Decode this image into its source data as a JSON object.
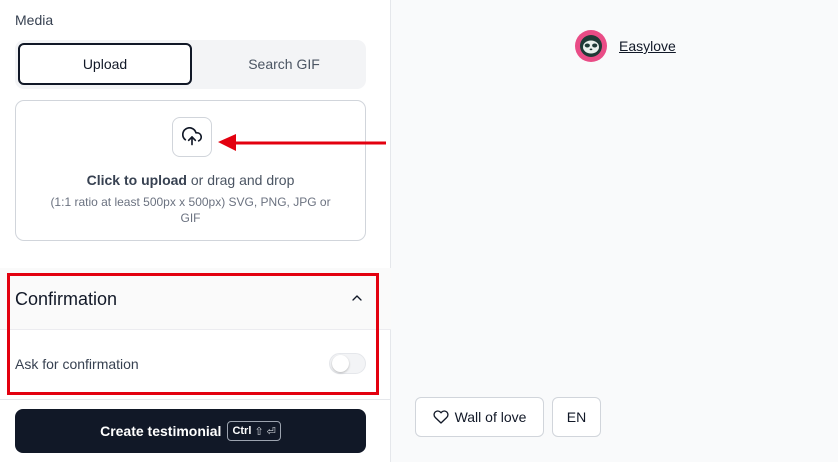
{
  "media": {
    "label": "Media",
    "tabs": [
      {
        "label": "Upload",
        "active": true
      },
      {
        "label": "Search GIF",
        "active": false
      }
    ],
    "dropzone": {
      "icon": "upload-cloud-icon",
      "click_text": "Click to upload",
      "rest_text": " or drag and drop",
      "hint": "(1:1 ratio at least 500px x 500px) SVG, PNG, JPG or GIF"
    }
  },
  "confirmation": {
    "title": "Confirmation",
    "expanded": true,
    "row_label": "Ask for confirmation",
    "toggle_on": false
  },
  "create_button": {
    "label": "Create testimonial",
    "shortcut_key": "Ctrl",
    "shortcut_symbols": "⇧ ⏎"
  },
  "preview": {
    "brand_name": "Easylove",
    "wall_label": "Wall of love",
    "language": "EN"
  },
  "colors": {
    "accent_dark": "#111827",
    "annotation_red": "#e3000f",
    "brand_pink": "#e94c86"
  }
}
